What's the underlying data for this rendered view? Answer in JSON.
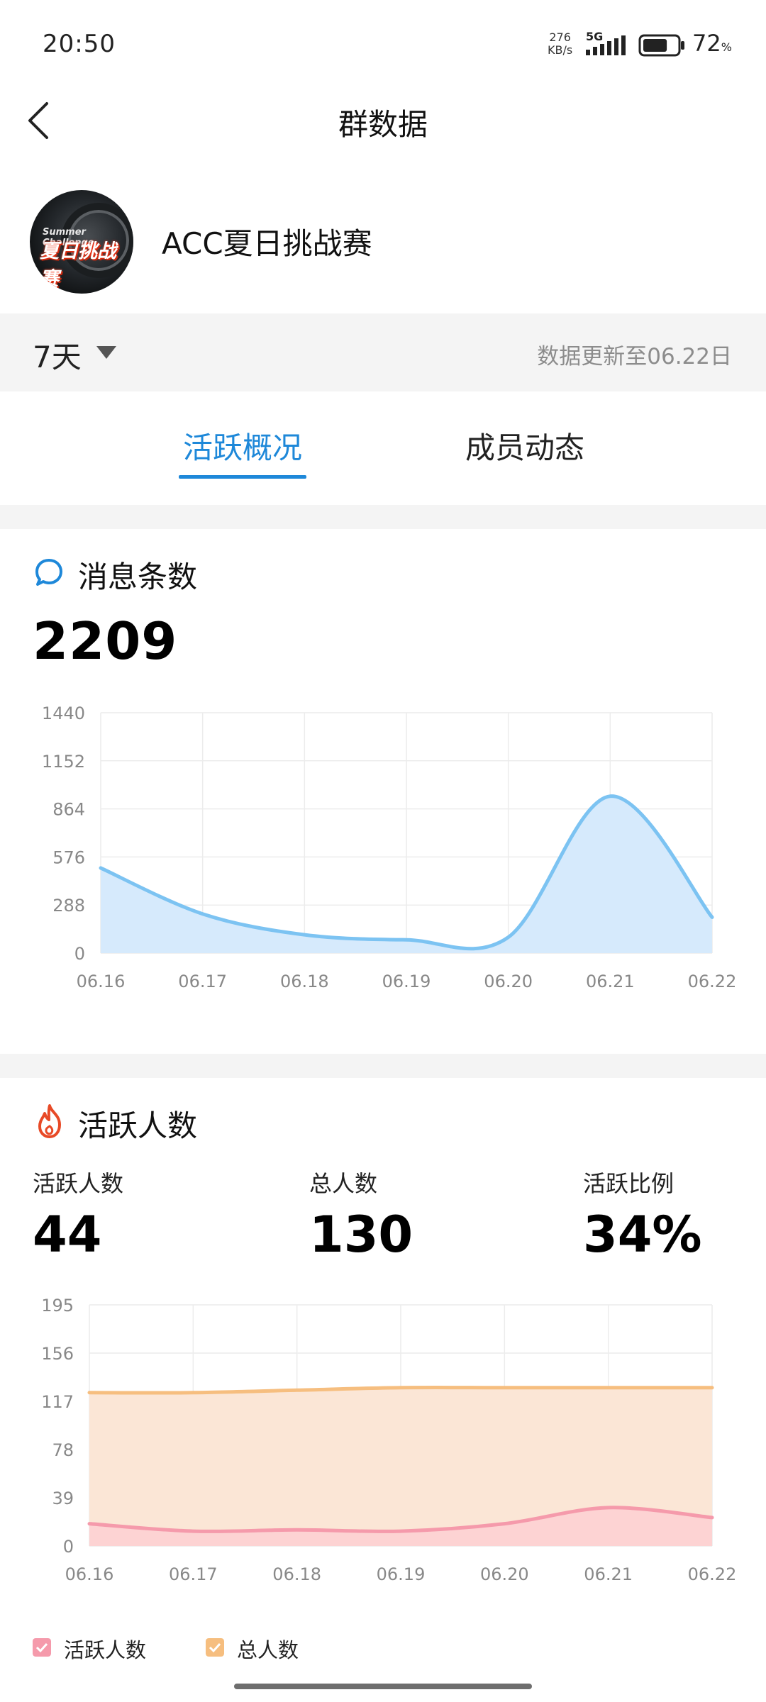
{
  "status_bar": {
    "time": "20:50",
    "net_speed_value": "276",
    "net_speed_unit": "KB/s",
    "network_type": "5G",
    "battery_percent": "72",
    "battery_unit": "%",
    "battery_level": 0.72,
    "signal_icon": "signal-bars-icon",
    "battery_icon": "battery-icon"
  },
  "header": {
    "title": "群数据",
    "back_icon": "chevron-left-icon"
  },
  "group": {
    "name": "ACC夏日挑战赛",
    "avatar_text_small": "Summer Challenge",
    "avatar_text_large": "夏日挑战赛"
  },
  "filter": {
    "period": "7天",
    "update_text": "数据更新至06.22日"
  },
  "tabs": [
    {
      "label": "活跃概况",
      "active": true
    },
    {
      "label": "成员动态",
      "active": false
    }
  ],
  "messages": {
    "title": "消息条数",
    "icon": "chat-bubble-icon",
    "total": "2209"
  },
  "active": {
    "title": "活跃人数",
    "icon": "flame-icon",
    "stats": [
      {
        "label": "活跃人数",
        "value": "44"
      },
      {
        "label": "总人数",
        "value": "130"
      },
      {
        "label": "活跃比例",
        "value": "34%"
      }
    ]
  },
  "colors": {
    "accent": "#1e88d9",
    "message_line": "#7cc3f2",
    "message_fill": "#d6eafc",
    "active_line": "#f59aab",
    "active_fill": "#fdd3d3",
    "total_line": "#f6be7f",
    "total_fill": "#fbe6d6"
  },
  "chart_data": [
    {
      "type": "area",
      "x": [
        "06.16",
        "06.17",
        "06.18",
        "06.19",
        "06.20",
        "06.21",
        "06.22"
      ],
      "ylim": [
        0,
        1440
      ],
      "yticks": [
        "1440",
        "1152",
        "864",
        "576",
        "288",
        "0"
      ],
      "grid": true,
      "series": [
        {
          "values": [
            510,
            235,
            110,
            80,
            95,
            940,
            215
          ]
        }
      ]
    },
    {
      "type": "area",
      "x": [
        "06.16",
        "06.17",
        "06.18",
        "06.19",
        "06.20",
        "06.21",
        "06.22"
      ],
      "ylim": [
        0,
        195
      ],
      "yticks": [
        "195",
        "156",
        "117",
        "78",
        "39",
        "0"
      ],
      "grid": true,
      "legend_position": "bottom-left",
      "series": [
        {
          "name": "活跃人数",
          "values": [
            18,
            12,
            13,
            12,
            18,
            31,
            23
          ]
        },
        {
          "name": "总人数",
          "values": [
            124,
            124,
            126,
            128,
            128,
            128,
            128
          ]
        }
      ]
    }
  ]
}
